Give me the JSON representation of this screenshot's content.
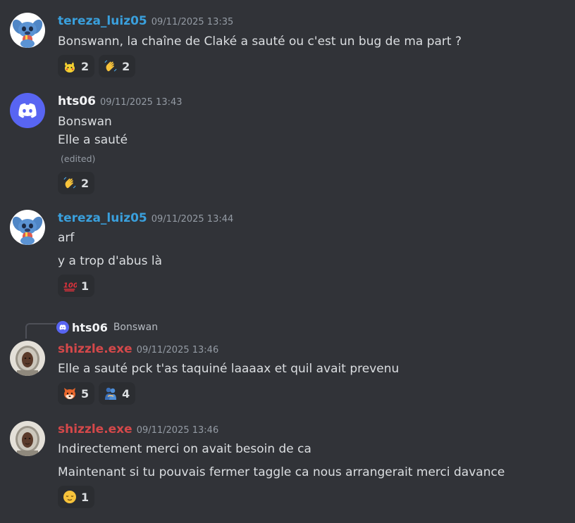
{
  "colors": {
    "background": "#313338",
    "user_tereza": "#3aa0dd",
    "user_hts06": "#f2f3f5",
    "user_shizzle": "#d4484a",
    "discord_blurple": "#5865f2"
  },
  "messages": [
    {
      "username": "tereza_luiz05",
      "timestamp": "09/11/2025 13:35",
      "lines": [
        "Bonswann, la chaîne de Claké a sauté ou c'est un bug de ma part ?"
      ],
      "reactions": [
        {
          "emoji": "pikachu-emoji",
          "count": "2"
        },
        {
          "emoji": "waving-hand-emoji",
          "count": "2"
        }
      ]
    },
    {
      "username": "hts06",
      "timestamp": "09/11/2025 13:43",
      "lines": [
        "Bonswan",
        "Elle a sauté"
      ],
      "edited": "(edited)",
      "reactions": [
        {
          "emoji": "waving-hand-emoji",
          "count": "2"
        }
      ]
    },
    {
      "username": "tereza_luiz05",
      "timestamp": "09/11/2025 13:44",
      "lines": [
        "arf",
        "y a trop d'abus là"
      ],
      "reactions": [
        {
          "emoji": "hundred-points-emoji",
          "count": "1"
        }
      ]
    },
    {
      "reply": {
        "username": "hts06",
        "text": "Bonswan"
      },
      "username": "shizzle.exe",
      "timestamp": "09/11/2025 13:46",
      "lines": [
        "Elle a sauté pck t'as taquiné laaaax et quil avait prevenu"
      ],
      "reactions": [
        {
          "emoji": "fox-emoji",
          "count": "5"
        },
        {
          "emoji": "people-hugging-emoji",
          "count": "4"
        }
      ]
    },
    {
      "username": "shizzle.exe",
      "timestamp": "09/11/2025 13:46",
      "lines": [
        "Indirectement merci on avait besoin de ca",
        "Maintenant si tu pouvais fermer taggle ca nous arrangerait merci davance"
      ],
      "reactions": [
        {
          "emoji": "relieved-face-emoji",
          "count": "1"
        }
      ]
    }
  ]
}
